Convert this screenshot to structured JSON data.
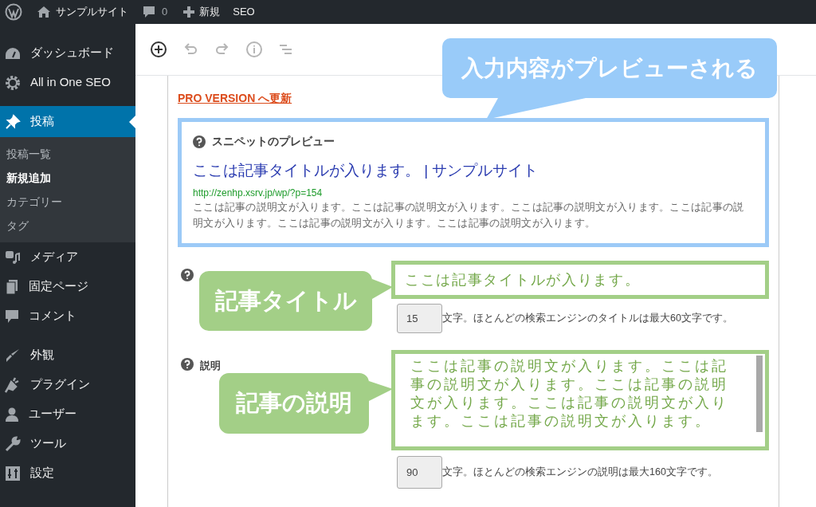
{
  "top_bar": {
    "site_name": "サンプルサイト",
    "comments": "0",
    "new_label": "新規",
    "seo_label": "SEO"
  },
  "sidebar": {
    "groups": [
      [
        {
          "label": "ダッシュボード",
          "selected": false
        },
        {
          "label": "All in One SEO",
          "selected": false
        }
      ],
      [
        {
          "label": "投稿",
          "selected": true,
          "children": [
            {
              "label": "投稿一覧",
              "selected": false
            },
            {
              "label": "新規追加",
              "selected": true
            },
            {
              "label": "カテゴリー",
              "selected": false
            },
            {
              "label": "タグ",
              "selected": false
            }
          ]
        },
        {
          "label": "メディア",
          "selected": false
        },
        {
          "label": "固定ページ",
          "selected": false
        },
        {
          "label": "コメント",
          "selected": false
        }
      ],
      [
        {
          "label": "外観",
          "selected": false
        },
        {
          "label": "プラグイン",
          "selected": false
        },
        {
          "label": "ユーザー",
          "selected": false
        },
        {
          "label": "ツール",
          "selected": false
        },
        {
          "label": "設定",
          "selected": false
        }
      ]
    ]
  },
  "seo_panel": {
    "upgrade_link": "PRO VERSION へ更新",
    "snippet_preview": {
      "label": "スニペットのプレビュー",
      "title": "ここは記事タイトルが入ります。 | サンプルサイト",
      "url": "http://zenhp.xsrv.jp/wp/?p=154",
      "description": "ここは記事の説明文が入ります。ここは記事の説明文が入ります。ここは記事の説明文が入ります。ここは記事の説明文が入ります。ここは記事の説明文が入ります。ここは記事の説明文が入ります。"
    },
    "title_field": {
      "value": "ここは記事タイトルが入ります。",
      "count": "15",
      "note": "文字。ほとんどの検索エンジンのタイトルは最大60文字です。"
    },
    "description_field": {
      "label": "説明",
      "value": "ここは記事の説明文が入ります。ここは記事の説明文が入ります。ここは記事の説明文が入ります。ここは記事の説明文が入ります。ここは記事の説明文が入ります。",
      "count": "90",
      "note": "文字。ほとんどの検索エンジンの説明は最大160文字です。"
    }
  },
  "callouts": [
    {
      "text": "入力内容がプレビューされる",
      "color": "#99cbf9"
    },
    {
      "text": "記事タイトル",
      "color": "#a3cf87"
    },
    {
      "text": "記事の説明",
      "color": "#a3cf87"
    }
  ]
}
